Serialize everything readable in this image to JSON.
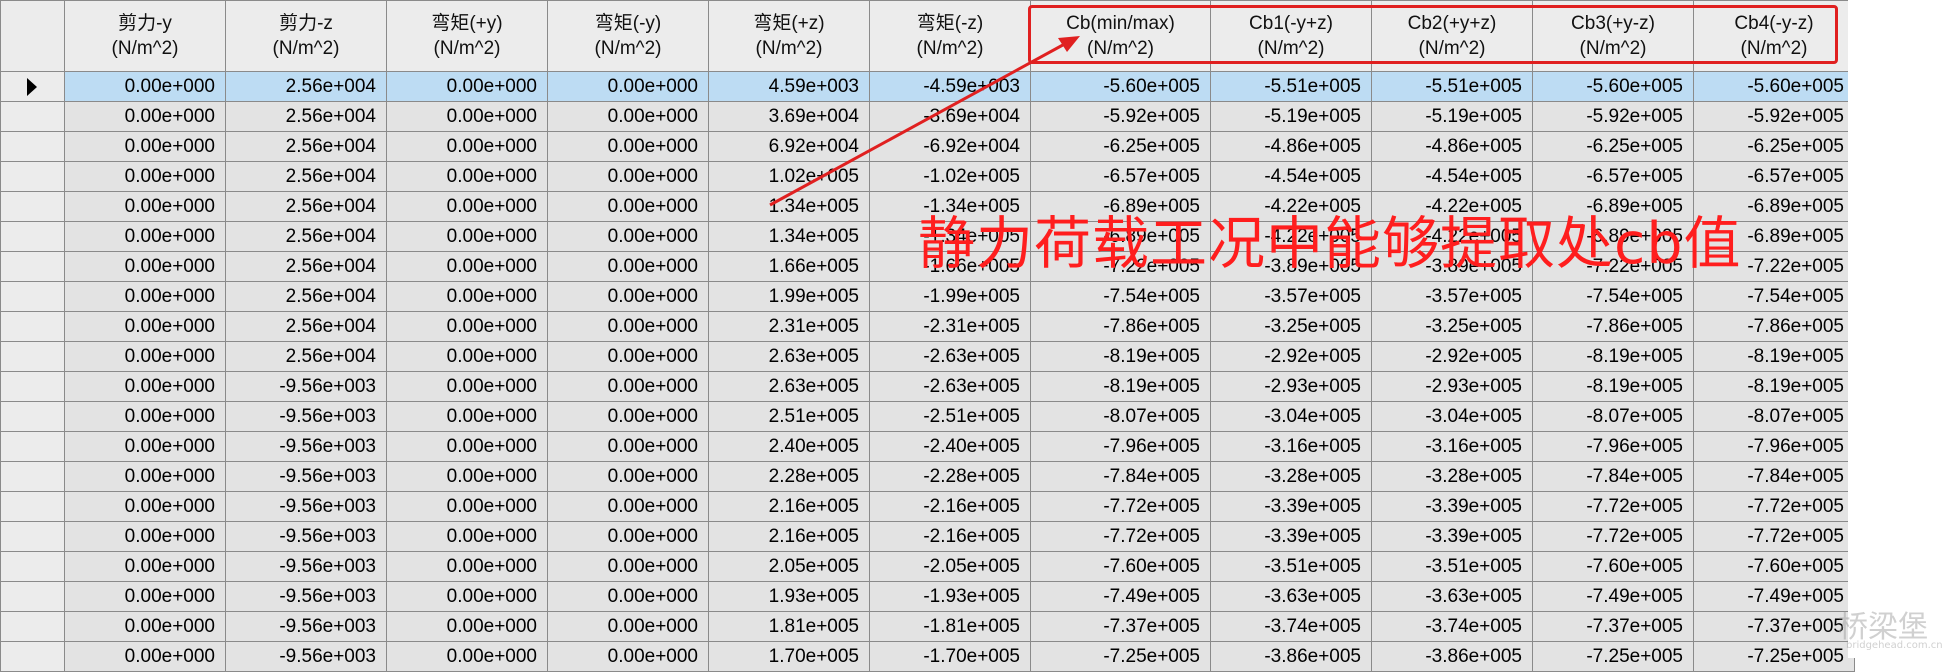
{
  "columns": [
    {
      "name": "剪力-y",
      "unit": "(N/m^2)"
    },
    {
      "name": "剪力-z",
      "unit": "(N/m^2)"
    },
    {
      "name": "弯矩(+y)",
      "unit": "(N/m^2)"
    },
    {
      "name": "弯矩(-y)",
      "unit": "(N/m^2)"
    },
    {
      "name": "弯矩(+z)",
      "unit": "(N/m^2)"
    },
    {
      "name": "弯矩(-z)",
      "unit": "(N/m^2)"
    },
    {
      "name": "Cb(min/max)",
      "unit": "(N/m^2)"
    },
    {
      "name": "Cb1(-y+z)",
      "unit": "(N/m^2)"
    },
    {
      "name": "Cb2(+y+z)",
      "unit": "(N/m^2)"
    },
    {
      "name": "Cb3(+y-z)",
      "unit": "(N/m^2)"
    },
    {
      "name": "Cb4(-y-z)",
      "unit": "(N/m^2)"
    }
  ],
  "rows": [
    [
      "0.00e+000",
      "2.56e+004",
      "0.00e+000",
      "0.00e+000",
      "4.59e+003",
      "-4.59e+003",
      "-5.60e+005",
      "-5.51e+005",
      "-5.51e+005",
      "-5.60e+005",
      "-5.60e+005"
    ],
    [
      "0.00e+000",
      "2.56e+004",
      "0.00e+000",
      "0.00e+000",
      "3.69e+004",
      "-3.69e+004",
      "-5.92e+005",
      "-5.19e+005",
      "-5.19e+005",
      "-5.92e+005",
      "-5.92e+005"
    ],
    [
      "0.00e+000",
      "2.56e+004",
      "0.00e+000",
      "0.00e+000",
      "6.92e+004",
      "-6.92e+004",
      "-6.25e+005",
      "-4.86e+005",
      "-4.86e+005",
      "-6.25e+005",
      "-6.25e+005"
    ],
    [
      "0.00e+000",
      "2.56e+004",
      "0.00e+000",
      "0.00e+000",
      "1.02e+005",
      "-1.02e+005",
      "-6.57e+005",
      "-4.54e+005",
      "-4.54e+005",
      "-6.57e+005",
      "-6.57e+005"
    ],
    [
      "0.00e+000",
      "2.56e+004",
      "0.00e+000",
      "0.00e+000",
      "1.34e+005",
      "-1.34e+005",
      "-6.89e+005",
      "-4.22e+005",
      "-4.22e+005",
      "-6.89e+005",
      "-6.89e+005"
    ],
    [
      "0.00e+000",
      "2.56e+004",
      "0.00e+000",
      "0.00e+000",
      "1.34e+005",
      "-1.34e+005",
      "-6.89e+005",
      "-4.22e+005",
      "-4.22e+005",
      "-6.89e+005",
      "-6.89e+005"
    ],
    [
      "0.00e+000",
      "2.56e+004",
      "0.00e+000",
      "0.00e+000",
      "1.66e+005",
      "-1.66e+005",
      "-7.22e+005",
      "-3.89e+005",
      "-3.89e+005",
      "-7.22e+005",
      "-7.22e+005"
    ],
    [
      "0.00e+000",
      "2.56e+004",
      "0.00e+000",
      "0.00e+000",
      "1.99e+005",
      "-1.99e+005",
      "-7.54e+005",
      "-3.57e+005",
      "-3.57e+005",
      "-7.54e+005",
      "-7.54e+005"
    ],
    [
      "0.00e+000",
      "2.56e+004",
      "0.00e+000",
      "0.00e+000",
      "2.31e+005",
      "-2.31e+005",
      "-7.86e+005",
      "-3.25e+005",
      "-3.25e+005",
      "-7.86e+005",
      "-7.86e+005"
    ],
    [
      "0.00e+000",
      "2.56e+004",
      "0.00e+000",
      "0.00e+000",
      "2.63e+005",
      "-2.63e+005",
      "-8.19e+005",
      "-2.92e+005",
      "-2.92e+005",
      "-8.19e+005",
      "-8.19e+005"
    ],
    [
      "0.00e+000",
      "-9.56e+003",
      "0.00e+000",
      "0.00e+000",
      "2.63e+005",
      "-2.63e+005",
      "-8.19e+005",
      "-2.93e+005",
      "-2.93e+005",
      "-8.19e+005",
      "-8.19e+005"
    ],
    [
      "0.00e+000",
      "-9.56e+003",
      "0.00e+000",
      "0.00e+000",
      "2.51e+005",
      "-2.51e+005",
      "-8.07e+005",
      "-3.04e+005",
      "-3.04e+005",
      "-8.07e+005",
      "-8.07e+005"
    ],
    [
      "0.00e+000",
      "-9.56e+003",
      "0.00e+000",
      "0.00e+000",
      "2.40e+005",
      "-2.40e+005",
      "-7.96e+005",
      "-3.16e+005",
      "-3.16e+005",
      "-7.96e+005",
      "-7.96e+005"
    ],
    [
      "0.00e+000",
      "-9.56e+003",
      "0.00e+000",
      "0.00e+000",
      "2.28e+005",
      "-2.28e+005",
      "-7.84e+005",
      "-3.28e+005",
      "-3.28e+005",
      "-7.84e+005",
      "-7.84e+005"
    ],
    [
      "0.00e+000",
      "-9.56e+003",
      "0.00e+000",
      "0.00e+000",
      "2.16e+005",
      "-2.16e+005",
      "-7.72e+005",
      "-3.39e+005",
      "-3.39e+005",
      "-7.72e+005",
      "-7.72e+005"
    ],
    [
      "0.00e+000",
      "-9.56e+003",
      "0.00e+000",
      "0.00e+000",
      "2.16e+005",
      "-2.16e+005",
      "-7.72e+005",
      "-3.39e+005",
      "-3.39e+005",
      "-7.72e+005",
      "-7.72e+005"
    ],
    [
      "0.00e+000",
      "-9.56e+003",
      "0.00e+000",
      "0.00e+000",
      "2.05e+005",
      "-2.05e+005",
      "-7.60e+005",
      "-3.51e+005",
      "-3.51e+005",
      "-7.60e+005",
      "-7.60e+005"
    ],
    [
      "0.00e+000",
      "-9.56e+003",
      "0.00e+000",
      "0.00e+000",
      "1.93e+005",
      "-1.93e+005",
      "-7.49e+005",
      "-3.63e+005",
      "-3.63e+005",
      "-7.49e+005",
      "-7.49e+005"
    ],
    [
      "0.00e+000",
      "-9.56e+003",
      "0.00e+000",
      "0.00e+000",
      "1.81e+005",
      "-1.81e+005",
      "-7.37e+005",
      "-3.74e+005",
      "-3.74e+005",
      "-7.37e+005",
      "-7.37e+005"
    ],
    [
      "0.00e+000",
      "-9.56e+003",
      "0.00e+000",
      "0.00e+000",
      "1.70e+005",
      "-1.70e+005",
      "-7.25e+005",
      "-3.86e+005",
      "-3.86e+005",
      "-7.25e+005",
      "-7.25e+005"
    ]
  ],
  "selected_row": 0,
  "annotation": {
    "text": "静力荷载工况中能够提取处cb值",
    "color": "#ff1e1e"
  },
  "watermark": {
    "text": "桥梁堡",
    "sub": "bridgehead.com.cn"
  },
  "colors": {
    "selected_row": "#bddcf3",
    "cell_bg": "#e3e3e3",
    "header_bg": "#ececec",
    "grid_line": "#8a8a8a",
    "highlight": "#e02020"
  }
}
